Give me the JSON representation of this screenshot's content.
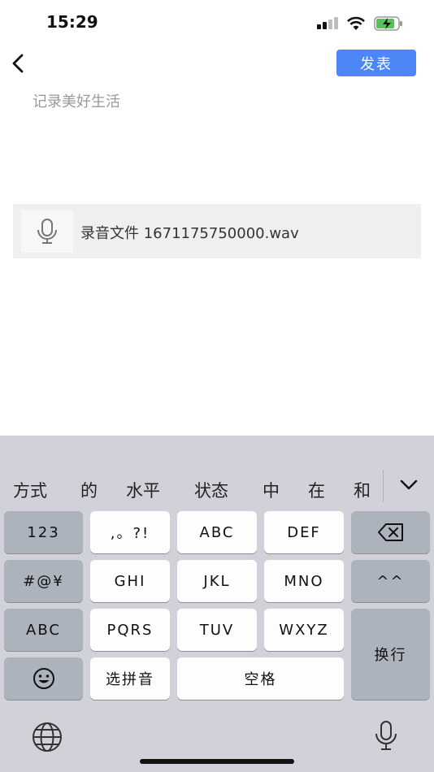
{
  "status_bar": {
    "time": "15:29"
  },
  "nav": {
    "publish_label": "发表"
  },
  "editor": {
    "placeholder": "记录美好生活"
  },
  "attachment": {
    "file_name": "录音文件 1671175750000.wav"
  },
  "keyboard": {
    "candidates": [
      "方式",
      "的",
      "水平",
      "状态",
      "中",
      "在",
      "和"
    ],
    "keys": {
      "num": "123",
      "punct": ",。?!",
      "abc": "ABC",
      "def": "DEF",
      "symbols": "#@¥",
      "ghi": "GHI",
      "jkl": "JKL",
      "mno": "MNO",
      "caret": "^^",
      "abc_switch": "ABC",
      "pqrs": "PQRS",
      "tuv": "TUV",
      "wxyz": "WXYZ",
      "enter": "换行",
      "pinyin": "选拼音",
      "space": "空格"
    }
  }
}
